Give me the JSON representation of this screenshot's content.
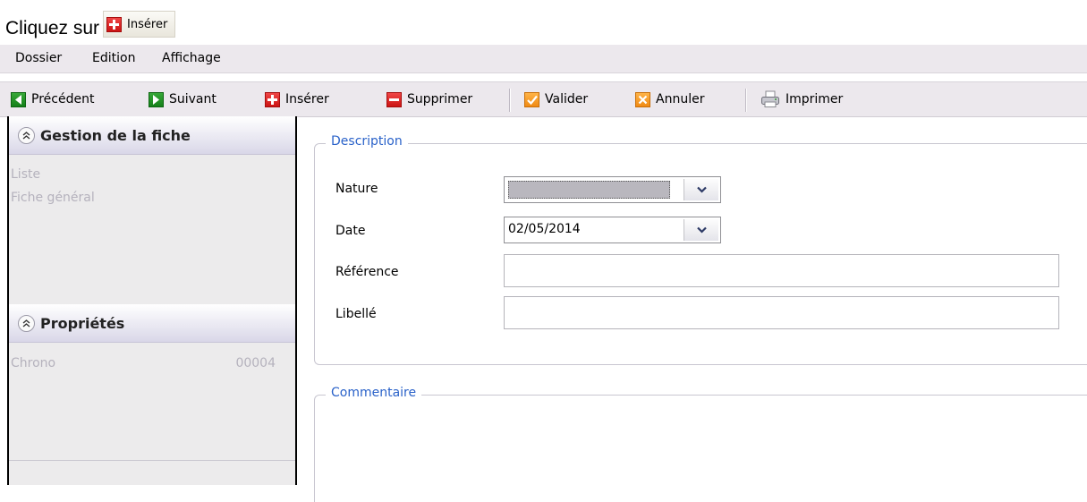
{
  "instruction": {
    "text": "Cliquez sur",
    "button_label": "Insérer"
  },
  "menu": [
    "Dossier",
    "Edition",
    "Affichage"
  ],
  "toolbar": {
    "previous": "Précédent",
    "next": "Suivant",
    "insert": "Insérer",
    "delete": "Supprimer",
    "validate": "Valider",
    "cancel": "Annuler",
    "print": "Imprimer"
  },
  "sidebar": {
    "section1": {
      "title": "Gestion de la fiche",
      "links": [
        "Liste",
        "Fiche général"
      ]
    },
    "section2": {
      "title": "Propriétés",
      "properties": [
        {
          "label": "Chrono",
          "value": "00004"
        }
      ]
    }
  },
  "description": {
    "legend": "Description",
    "fields": {
      "nature": {
        "label": "Nature",
        "value": ""
      },
      "date": {
        "label": "Date",
        "value": "02/05/2014"
      },
      "reference": {
        "label": "Référence",
        "value": ""
      },
      "libelle": {
        "label": "Libellé",
        "value": ""
      }
    }
  },
  "comment": {
    "legend": "Commentaire"
  },
  "colors": {
    "accent_blue": "#2a62c9",
    "toolbar_bg": "#ece8ed",
    "panel_bg": "#ecebec"
  }
}
